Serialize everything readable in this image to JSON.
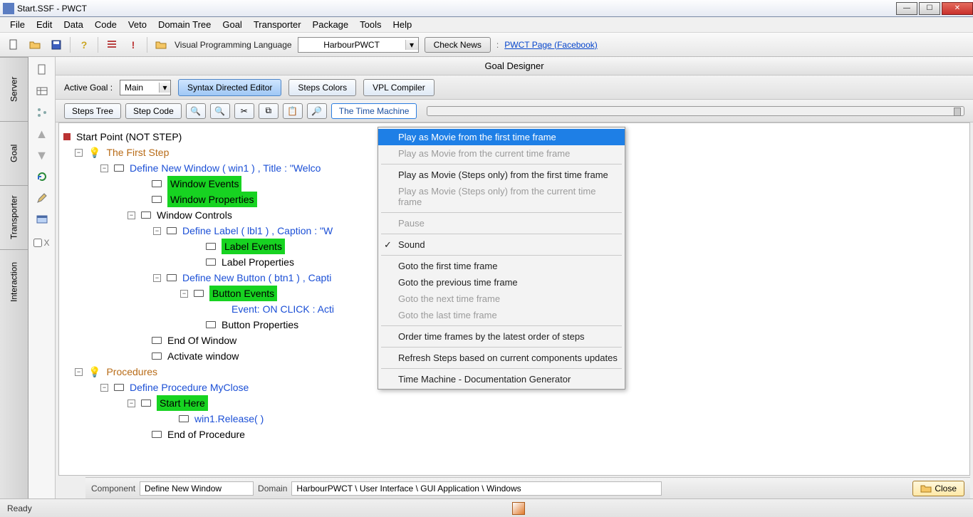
{
  "window": {
    "title": "Start.SSF - PWCT"
  },
  "menu": {
    "items": [
      "File",
      "Edit",
      "Data",
      "Code",
      "Veto",
      "Domain Tree",
      "Goal",
      "Transporter",
      "Package",
      "Tools",
      "Help"
    ]
  },
  "toolbar": {
    "lang_label": "Visual Programming Language",
    "lang_value": "HarbourPWCT",
    "check_news": "Check News",
    "link_sep": ":",
    "link": "PWCT Page (Facebook)"
  },
  "left_tabs": [
    "Server",
    "Goal",
    "Transporter",
    "Interaction"
  ],
  "left_icons_chk_label": "X",
  "designer": {
    "title": "Goal Designer",
    "active_goal_label": "Active Goal :",
    "active_goal_value": "Main",
    "syntax_btn": "Syntax Directed Editor",
    "steps_colors": "Steps Colors",
    "vpl": "VPL Compiler",
    "steps_tree": "Steps Tree",
    "step_code": "Step Code",
    "time_machine": "The Time Machine"
  },
  "context_menu": {
    "items": [
      {
        "label": "Play as Movie from the first time frame",
        "state": "highlight"
      },
      {
        "label": "Play as Movie from the current time frame",
        "state": "disabled"
      },
      {
        "sep": true
      },
      {
        "label": "Play as Movie (Steps only) from the first time frame",
        "state": "normal"
      },
      {
        "label": "Play as Movie (Steps only) from the current time frame",
        "state": "disabled"
      },
      {
        "sep": true
      },
      {
        "label": "Pause",
        "state": "disabled"
      },
      {
        "sep": true
      },
      {
        "label": "Sound",
        "state": "normal",
        "check": true
      },
      {
        "sep": true
      },
      {
        "label": "Goto the first time frame",
        "state": "normal"
      },
      {
        "label": "Goto the previous time frame",
        "state": "normal"
      },
      {
        "label": "Goto the next time frame",
        "state": "disabled"
      },
      {
        "label": "Goto the last time frame",
        "state": "disabled"
      },
      {
        "sep": true
      },
      {
        "label": "Order time frames by the latest order of steps",
        "state": "normal"
      },
      {
        "sep": true
      },
      {
        "label": "Refresh Steps based on current components updates",
        "state": "normal"
      },
      {
        "sep": true
      },
      {
        "label": "Time Machine - Documentation Generator",
        "state": "normal"
      }
    ]
  },
  "tree": {
    "root": "Start Point (NOT STEP)",
    "first_step": "The First Step",
    "def_window": "Define New Window  ( win1 ) , Title : \"Welco",
    "window_events": "Window Events",
    "window_props": "Window Properties",
    "window_controls": "Window Controls",
    "def_label": "Define Label ( lbl1 ) , Caption : \"W",
    "label_events": "Label Events",
    "label_props": "Label Properties",
    "def_button": "Define New Button ( btn1 ) , Capti",
    "button_events": "Button Events",
    "event_click": "Event: ON CLICK : Acti",
    "button_props": "Button Properties",
    "end_window": "End Of Window",
    "activate": "Activate window",
    "procedures": "Procedures",
    "def_proc": "Define Procedure MyClose",
    "start_here": "Start Here",
    "release": "win1.Release( )",
    "end_proc": "End of Procedure"
  },
  "component_bar": {
    "component_label": "Component",
    "component_value": "Define New Window",
    "domain_label": "Domain",
    "domain_value": "HarbourPWCT  \\  User Interface  \\  GUI Application  \\  Windows",
    "close": "Close"
  },
  "status": {
    "ready": "Ready"
  }
}
